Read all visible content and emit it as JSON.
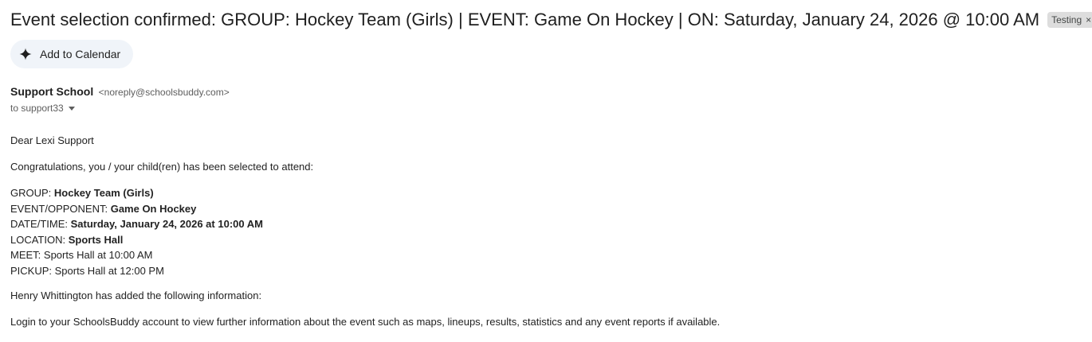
{
  "email": {
    "subject": "Event selection confirmed: GROUP: Hockey Team (Girls) | EVENT: Game On Hockey | ON: Saturday, January 24, 2026 @ 10:00 AM",
    "label": "Testing",
    "label_remove_glyph": "×",
    "add_to_calendar_label": "Add to Calendar",
    "sender_name": "Support School",
    "sender_email": "<noreply@schoolsbuddy.com>",
    "recipient": "to support33",
    "greeting": "Dear Lexi Support",
    "intro": "Congratulations, you / your child(ren) has been selected to attend:",
    "details": {
      "group_label": "GROUP: ",
      "group_value": "Hockey Team (Girls)",
      "event_label": "EVENT/OPPONENT: ",
      "event_value": "Game On Hockey",
      "datetime_label": "DATE/TIME: ",
      "datetime_value": "Saturday, January 24, 2026 at 10:00 AM",
      "location_label": "LOCATION: ",
      "location_value": "Sports Hall",
      "meet": "MEET: Sports Hall at 10:00 AM",
      "pickup": "PICKUP: Sports Hall at 12:00 PM"
    },
    "added_info": "Henry Whittington has added the following information:",
    "login_note": "Login to your SchoolsBuddy account to view further information about the event such as maps, lineups, results, statistics and any event reports if available."
  },
  "icons": {
    "calendar_button_icon": "sparkle-icon",
    "recipient_caret": "caret-down-icon"
  },
  "colors": {
    "button_bg": "#f0f4f9",
    "chip_bg": "#dddddd",
    "text": "#1f1f1f",
    "muted": "#5e5e5e"
  }
}
